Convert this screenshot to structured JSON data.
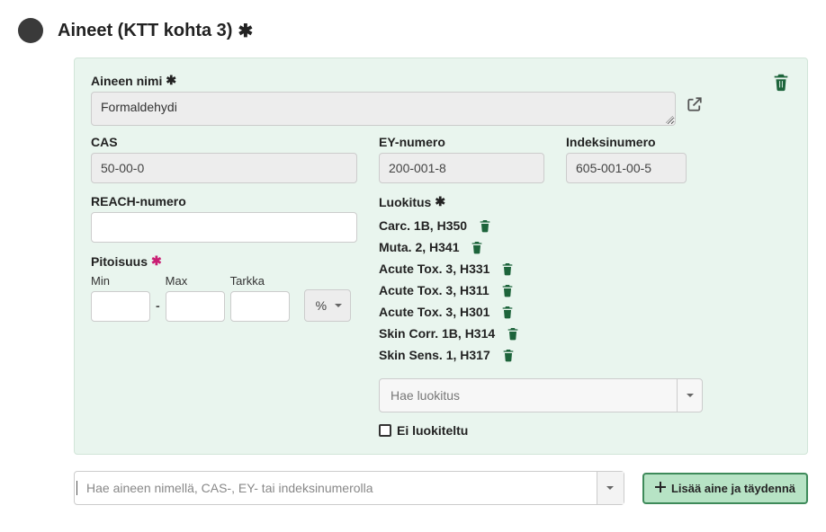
{
  "section": {
    "title": "Aineet (KTT kohta 3)"
  },
  "form": {
    "name_label": "Aineen nimi",
    "name_value": "Formaldehydi",
    "cas_label": "CAS",
    "cas_value": "50-00-0",
    "ey_label": "EY-numero",
    "ey_value": "200-001-8",
    "idx_label": "Indeksinumero",
    "idx_value": "605-001-00-5",
    "reach_label": "REACH-numero",
    "reach_value": "",
    "pitoisuus_label": "Pitoisuus",
    "min_label": "Min",
    "max_label": "Max",
    "tarkka_label": "Tarkka",
    "unit": "%",
    "luokitus_label": "Luokitus",
    "classifications": [
      "Carc. 1B, H350",
      "Muta. 2, H341",
      "Acute Tox. 3, H331",
      "Acute Tox. 3, H311",
      "Acute Tox. 3, H301",
      "Skin Corr. 1B, H314",
      "Skin Sens. 1, H317"
    ],
    "search_class_placeholder": "Hae luokitus",
    "not_classified_label": "Ei luokiteltu"
  },
  "footer": {
    "search_placeholder": "Hae aineen nimellä, CAS-, EY- tai indeksinumerolla",
    "add_button": "Lisää aine ja täydennä"
  }
}
